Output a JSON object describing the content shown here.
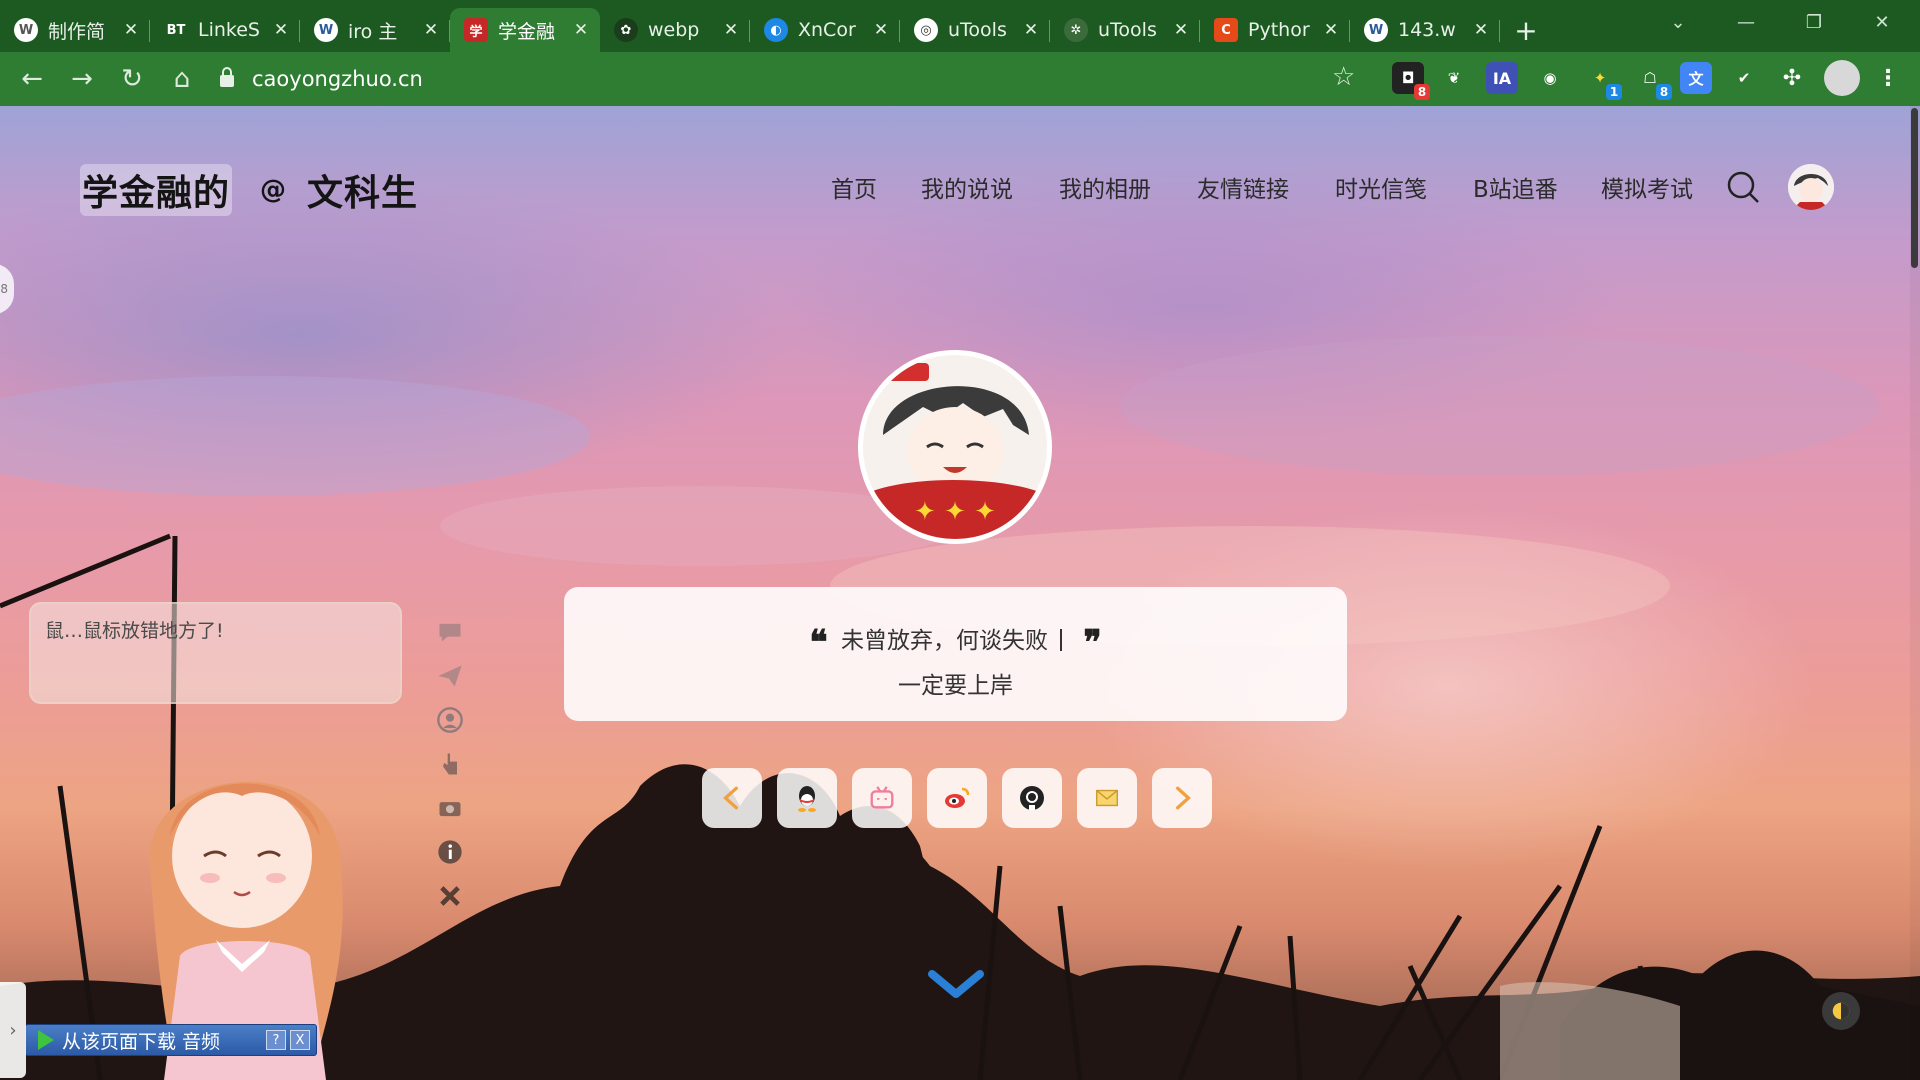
{
  "browser": {
    "tabs": [
      {
        "title": "制作简",
        "icon": "wordpress-icon",
        "color": "#ffffff"
      },
      {
        "title": "LinkeS",
        "icon": "bt-icon",
        "color": "#3b3b3b"
      },
      {
        "title": "iro 主",
        "icon": "wordpress-icon",
        "color": "#ffffff"
      },
      {
        "title": "学金融",
        "icon": "site-favicon",
        "color": "#c62828",
        "active": true
      },
      {
        "title": "webp",
        "icon": "leaf-icon",
        "color": "#1b3d1b"
      },
      {
        "title": "XnCor",
        "icon": "xnconvert-icon",
        "color": "#1e88e5"
      },
      {
        "title": "uTools",
        "icon": "globe-icon",
        "color": "#ffffff"
      },
      {
        "title": "uTools",
        "icon": "utools-icon",
        "color": "#3b6b3b"
      },
      {
        "title": "Pythor",
        "icon": "c-icon",
        "color": "#e64a19"
      },
      {
        "title": "143.w",
        "icon": "wordpress-icon",
        "color": "#ffffff"
      }
    ],
    "new_tab": "+",
    "url": "caoyongzhuo.cn",
    "extensions": [
      {
        "name": "extension-1",
        "badge": "8"
      },
      {
        "name": "extension-2"
      },
      {
        "name": "extension-ia",
        "label": "IA"
      },
      {
        "name": "extension-4"
      },
      {
        "name": "extension-5",
        "badge": "1"
      },
      {
        "name": "extension-6",
        "badge": "8"
      },
      {
        "name": "extension-translate"
      },
      {
        "name": "extension-check"
      }
    ]
  },
  "site": {
    "logo_main": "学金融的",
    "logo_at": "@",
    "logo_sub": "文科生",
    "nav": [
      "首页",
      "我的说说",
      "我的相册",
      "友情链接",
      "时光信笺",
      "B站追番",
      "模拟考试"
    ]
  },
  "hero": {
    "quote_line1": "未曾放弃，何谈失败",
    "quote_line2": "一定要上岸",
    "open_quote": "❝",
    "close_quote": "❞",
    "social": [
      "prev",
      "qq",
      "bilibili",
      "weibo",
      "github",
      "email",
      "next"
    ]
  },
  "mascot": {
    "message": "鼠…鼠标放错地方了!",
    "download_label": "从该页面下载 音频",
    "help": "?",
    "close": "X"
  },
  "colors": {
    "tabbar": "#1d5a22",
    "toolbar": "#2e7d32",
    "accent_arrow": "#f0a040",
    "down_arrow": "#2a7fd6"
  }
}
